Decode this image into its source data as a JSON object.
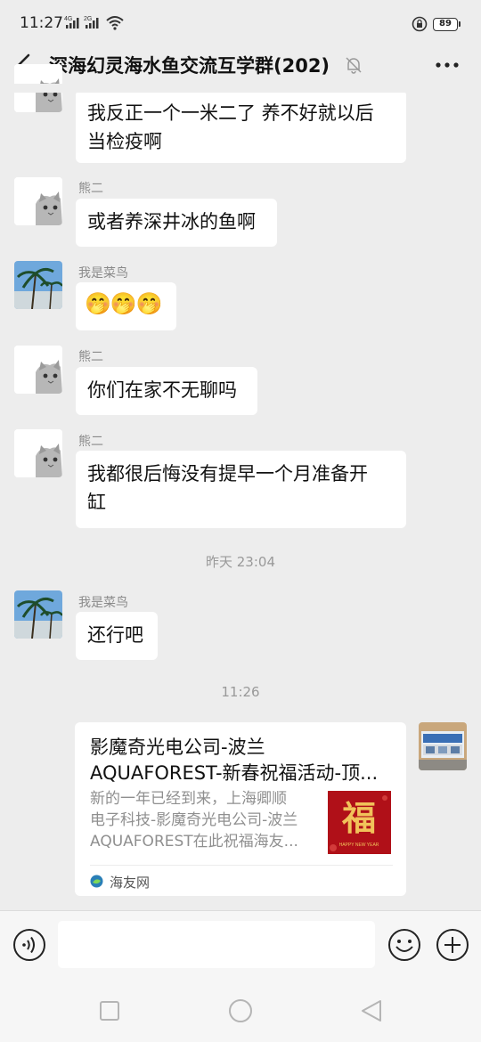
{
  "status_bar": {
    "time": "11:27",
    "sig1": "4G",
    "sig2": "2G",
    "battery": "89"
  },
  "header": {
    "title": "深海幻灵海水鱼交流互学群(202)"
  },
  "messages": [
    {
      "sender": "",
      "lines": [
        "我反正一个一米二了 养不好就以后",
        "当检疫啊"
      ]
    },
    {
      "sender": "熊二",
      "lines": [
        "或者养深井冰的鱼啊"
      ]
    },
    {
      "sender": "我是菜鸟",
      "emoji": "🤭🤭🤭"
    },
    {
      "sender": "熊二",
      "lines": [
        "你们在家不无聊吗"
      ]
    },
    {
      "sender": "熊二",
      "lines": [
        "我都很后悔没有提早一个月准备开",
        "缸"
      ]
    },
    {
      "sender": "我是菜鸟",
      "lines": [
        "还行吧"
      ]
    }
  ],
  "timestamps": [
    "昨天 23:04",
    "11:26"
  ],
  "link_card": {
    "title_lines": [
      "影魔奇光电公司-波兰",
      "AQUAFOREST-新春祝福活动-顶..."
    ],
    "desc_lines": [
      "新的一年已经到来，上海卿顺",
      "电子科技-影魔奇光电公司-波兰",
      "AQUAFOREST在此祝福海友..."
    ],
    "thumb_char": "福",
    "thumb_caption": "HAPPY NEW YEAR",
    "source": "海友网"
  },
  "input": {
    "placeholder": ""
  },
  "colors": {
    "background": "#ededed",
    "bubble": "#ffffff",
    "meta_text": "#8a8a8a",
    "thumb_red": "#b01018",
    "gold": "#f1c25a"
  },
  "icons": [
    "back-arrow",
    "mute-bell",
    "more-dots",
    "voice",
    "emoji",
    "plus",
    "square",
    "circle",
    "triangle-back"
  ]
}
